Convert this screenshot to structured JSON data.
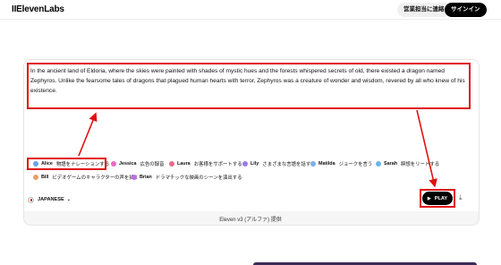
{
  "header": {
    "logo": "IIElevenLabs",
    "contact_sales": "営業担当に連絡",
    "signin": "サインイン"
  },
  "editor": {
    "text": "In the ancient land of Eldoria, where the skies were painted with shades of mystic hues and the forests whispered secrets of old, there existed a dragon named Zephyros. Unlike the fearsome tales of dragons that plagued human hearts with terror, Zephyros was a creature of wonder and wisdom, revered by all who knew of his existence."
  },
  "voices": [
    {
      "name": "Alice",
      "desc": "物語をナレーションする",
      "color": "#6aa2e8"
    },
    {
      "name": "Jessica",
      "desc": "広告の録音",
      "color": "#e86ac4"
    },
    {
      "name": "Laura",
      "desc": "お客様をサポートする",
      "color": "#e86a8a"
    },
    {
      "name": "Lily",
      "desc": "さまざまな言語を話す",
      "color": "#9a7be8"
    },
    {
      "name": "Matilda",
      "desc": "ジョークを言う",
      "color": "#7bb0e8"
    },
    {
      "name": "Sarah",
      "desc": "瞑想をリードする",
      "color": "#6ab5e8"
    },
    {
      "name": "Bill",
      "desc": "ビデオゲームのキャラクターの声を描く",
      "color": "#e8a06a"
    },
    {
      "name": "Brian",
      "desc": "ドラマチックな映画のシーンを演出する",
      "color": "#c06ae8"
    }
  ],
  "controls": {
    "language": "JAPANESE",
    "play_label": "PLAY",
    "play_icon": "play-icon",
    "download_icon": "download-icon"
  },
  "footer": {
    "powered_by": "Eleven v3 (アルファ) 提供"
  },
  "annotation": {
    "highlight_color": "#e01010"
  }
}
